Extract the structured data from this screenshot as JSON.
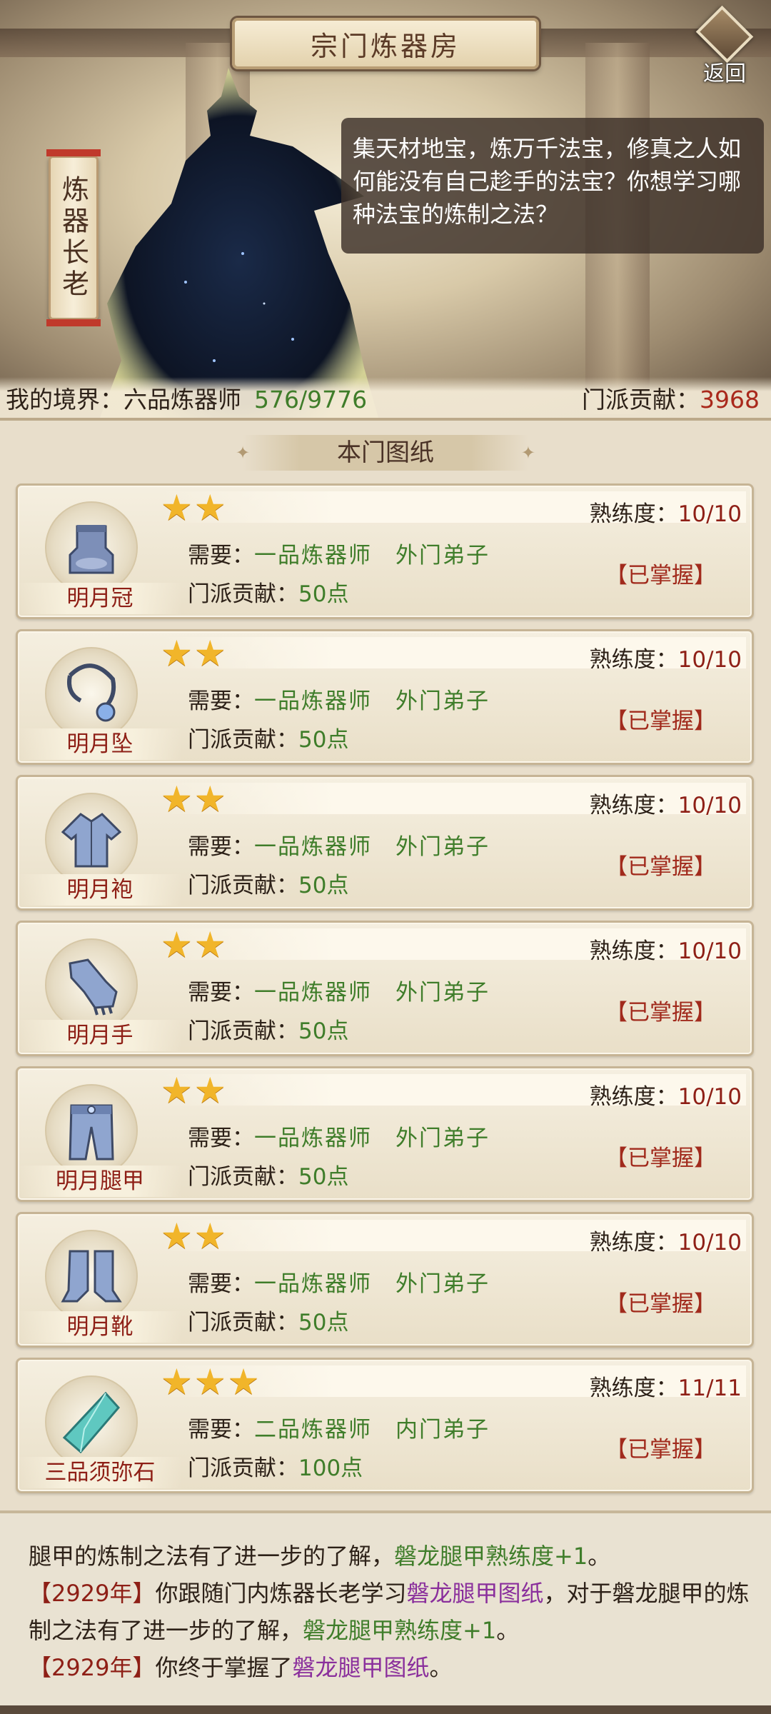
{
  "header": {
    "title": "宗门炼器房",
    "back_label": "返回",
    "npc_name": "炼器长老",
    "dialog": "集天材地宝，炼万千法宝，修真之人如何能没有自己趁手的法宝？你想学习哪种法宝的炼制之法？"
  },
  "status": {
    "realm_label": "我的境界：六品炼器师",
    "realm_exp": "576/9776",
    "contribution_label": "门派贡献：",
    "contribution_value": "3968"
  },
  "section_title": "本门图纸",
  "cards": [
    {
      "name": "明月冠",
      "stars": "★★",
      "mastery_label": "熟练度：",
      "mastery_value": "10/10",
      "req_label": "需要：",
      "req_value": "一品炼器师　外门弟子",
      "cost_label": "门派贡献：",
      "cost_value": "50点",
      "state": "【已掌握】",
      "icon": "helmet-icon"
    },
    {
      "name": "明月坠",
      "stars": "★★",
      "mastery_label": "熟练度：",
      "mastery_value": "10/10",
      "req_label": "需要：",
      "req_value": "一品炼器师　外门弟子",
      "cost_label": "门派贡献：",
      "cost_value": "50点",
      "state": "【已掌握】",
      "icon": "pendant-icon"
    },
    {
      "name": "明月袍",
      "stars": "★★",
      "mastery_label": "熟练度：",
      "mastery_value": "10/10",
      "req_label": "需要：",
      "req_value": "一品炼器师　外门弟子",
      "cost_label": "门派贡献：",
      "cost_value": "50点",
      "state": "【已掌握】",
      "icon": "robe-icon"
    },
    {
      "name": "明月手",
      "stars": "★★",
      "mastery_label": "熟练度：",
      "mastery_value": "10/10",
      "req_label": "需要：",
      "req_value": "一品炼器师　外门弟子",
      "cost_label": "门派贡献：",
      "cost_value": "50点",
      "state": "【已掌握】",
      "icon": "gauntlet-icon"
    },
    {
      "name": "明月腿甲",
      "stars": "★★",
      "mastery_label": "熟练度：",
      "mastery_value": "10/10",
      "req_label": "需要：",
      "req_value": "一品炼器师　外门弟子",
      "cost_label": "门派贡献：",
      "cost_value": "50点",
      "state": "【已掌握】",
      "icon": "leg-armor-icon"
    },
    {
      "name": "明月靴",
      "stars": "★★",
      "mastery_label": "熟练度：",
      "mastery_value": "10/10",
      "req_label": "需要：",
      "req_value": "一品炼器师　外门弟子",
      "cost_label": "门派贡献：",
      "cost_value": "50点",
      "state": "【已掌握】",
      "icon": "boots-icon"
    },
    {
      "name": "三品须弥石",
      "stars": "★★★",
      "mastery_label": "熟练度：",
      "mastery_value": "11/11",
      "req_label": "需要：",
      "req_value": "二品炼器师　内门弟子",
      "cost_label": "门派贡献：",
      "cost_value": "100点",
      "state": "【已掌握】",
      "icon": "crystal-icon"
    }
  ],
  "log": {
    "line1_a": "腿甲的炼制之法有了进一步的了解，",
    "line1_b": "磐龙腿甲熟练度+1",
    "line1_c": "。",
    "line2_year": "【2929年】",
    "line2_a": "你跟随门内炼器长老学习",
    "line2_b": "磐龙腿甲图纸",
    "line2_c": "，对于磐龙腿甲的炼制之法有了进一步的了解，",
    "line2_d": "磐龙腿甲熟练度+1",
    "line2_e": "。",
    "line3_year": "【2929年】",
    "line3_a": "你终于掌握了",
    "line3_b": "磐龙腿甲图纸",
    "line3_c": "。"
  }
}
